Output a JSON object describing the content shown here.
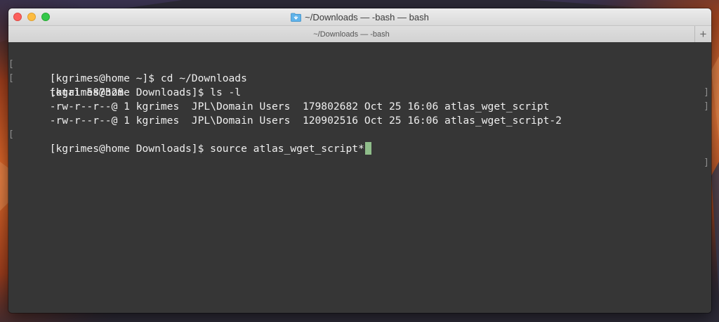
{
  "window": {
    "title": "~/Downloads — -bash — bash",
    "tab_label": "~/Downloads — -bash",
    "new_tab_label": "+"
  },
  "terminal": {
    "lines": [
      "[kgrimes@home ~]$ cd ~/Downloads",
      "[kgrimes@home Downloads]$ ls -l",
      "total 587328",
      "-rw-r--r--@ 1 kgrimes  JPL\\Domain Users  179802682 Oct 25 16:06 atlas_wget_script",
      "-rw-r--r--@ 1 kgrimes  JPL\\Domain Users  120902516 Oct 25 16:06 atlas_wget_script-2",
      "[kgrimes@home Downloads]$ source atlas_wget_script*"
    ]
  },
  "colors": {
    "terminal_bg": "#363636",
    "terminal_fg": "#efefef",
    "cursor": "#8fbd8a",
    "close": "#fc605c",
    "minimize": "#fdbc40",
    "maximize": "#34c84a"
  }
}
